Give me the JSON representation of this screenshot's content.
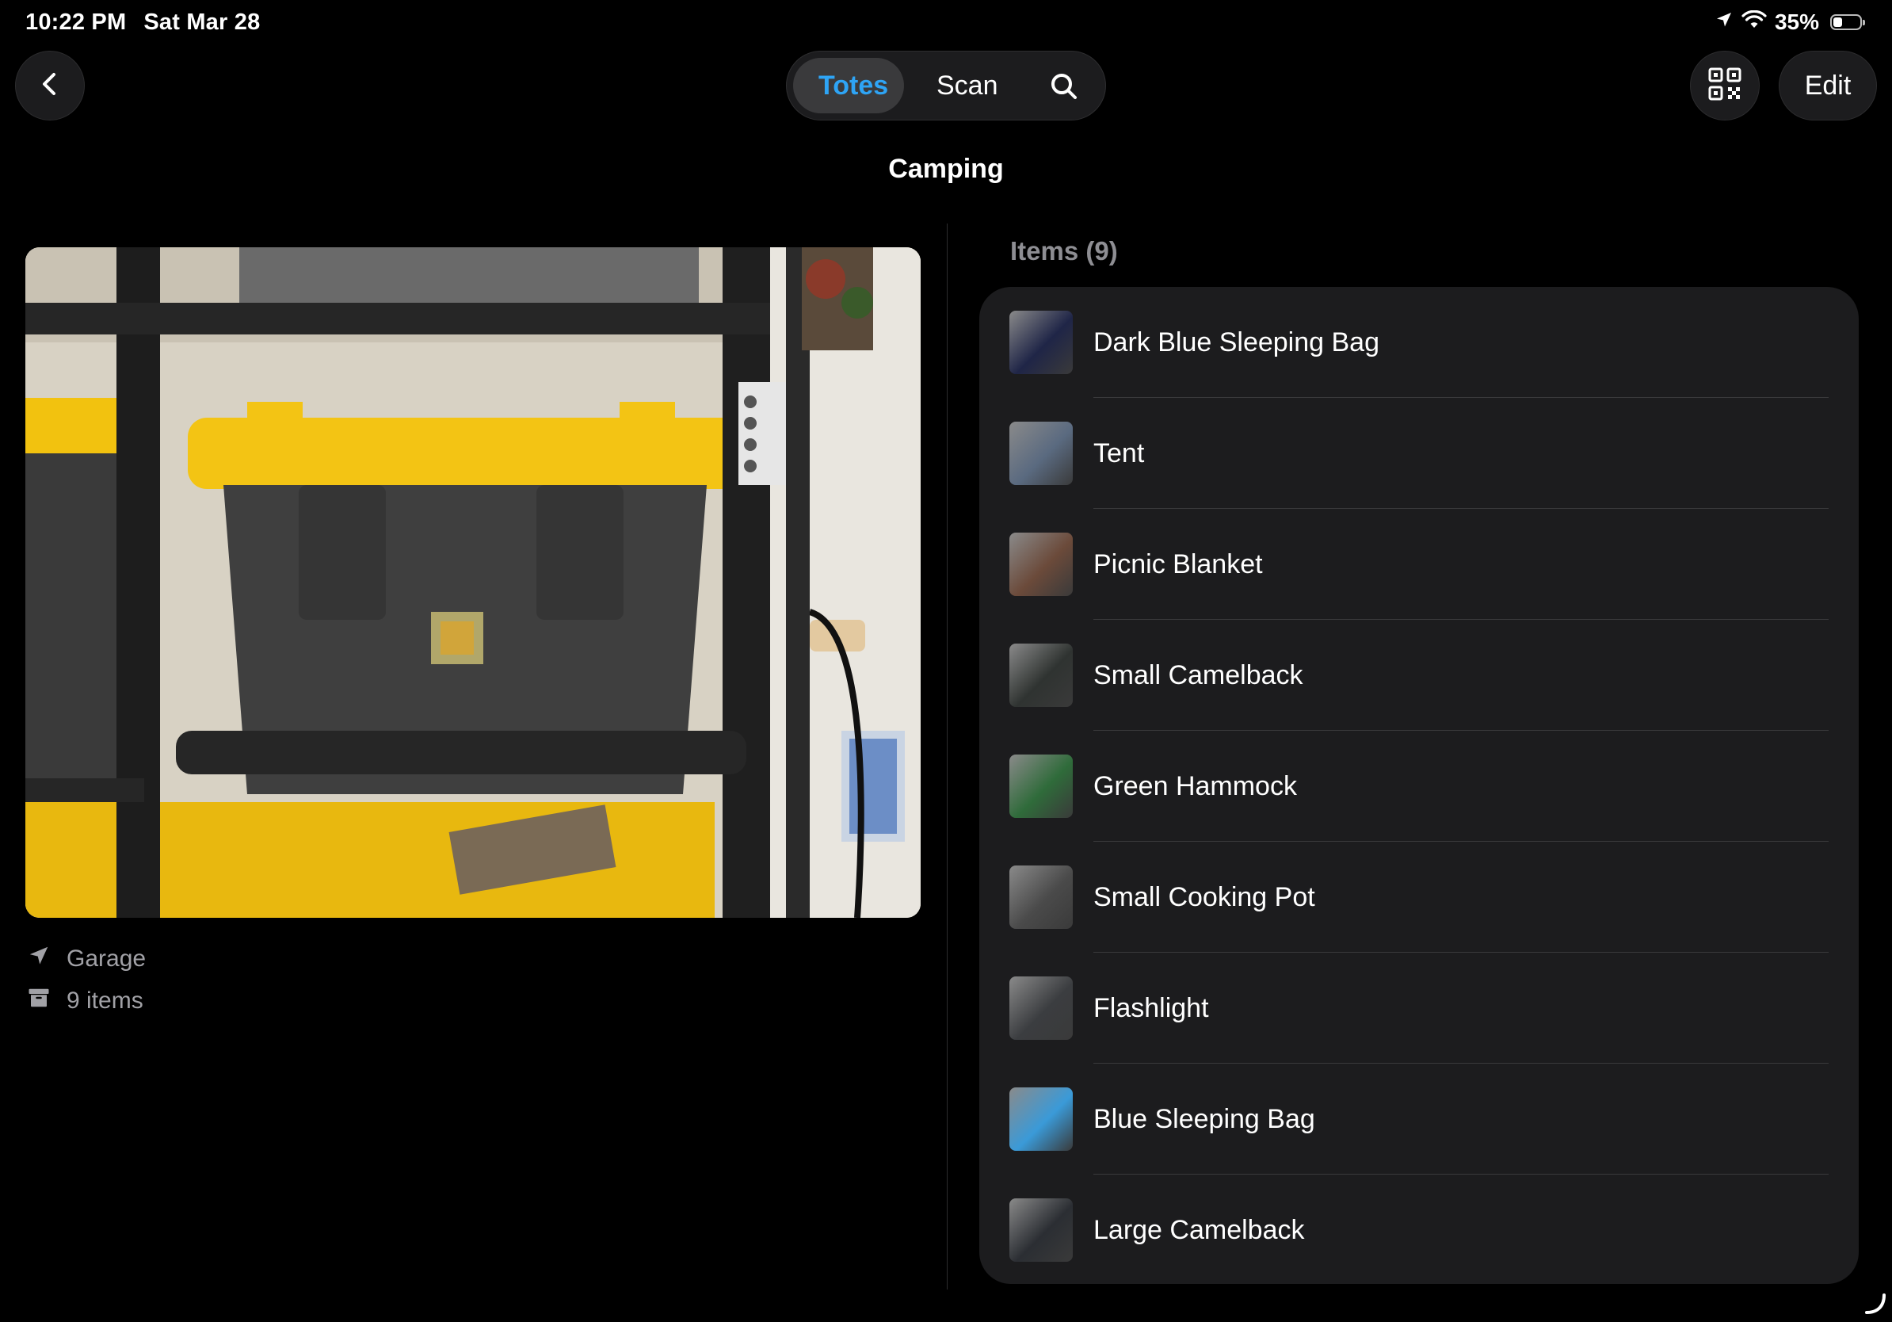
{
  "status_bar": {
    "time": "10:22 PM",
    "date": "Sat Mar 28",
    "battery_text": "35%",
    "battery_level": 0.35,
    "icons": [
      "location-arrow-icon",
      "wifi-icon",
      "battery-icon"
    ]
  },
  "nav": {
    "back_icon": "chevron-left-icon",
    "segments": {
      "totes": "Totes",
      "scan": "Scan",
      "search_icon": "search-icon"
    },
    "selected_segment": "totes",
    "qr_icon": "qr-code-icon",
    "edit_label": "Edit"
  },
  "page": {
    "title": "Camping"
  },
  "tote": {
    "location": "Garage",
    "count_text": "9 items",
    "location_icon": "location-arrow-icon",
    "count_icon": "archive-box-icon"
  },
  "items": {
    "header": "Items (9)",
    "list": [
      {
        "name": "Dark Blue Sleeping Bag",
        "thumb_color": "#1f2547"
      },
      {
        "name": "Tent",
        "thumb_color": "#5a6a80"
      },
      {
        "name": "Picnic Blanket",
        "thumb_color": "#6b4a3a"
      },
      {
        "name": "Small Camelback",
        "thumb_color": "#2f3331"
      },
      {
        "name": "Green Hammock",
        "thumb_color": "#2f6b3a"
      },
      {
        "name": "Small Cooking Pot",
        "thumb_color": "#4a4a4a"
      },
      {
        "name": "Flashlight",
        "thumb_color": "#3b3d40"
      },
      {
        "name": "Blue Sleeping Bag",
        "thumb_color": "#3a9ad8"
      },
      {
        "name": "Large Camelback",
        "thumb_color": "#2b2e33"
      }
    ]
  },
  "colors": {
    "accent": "#2ea4f5",
    "card": "#1c1c1e",
    "background": "#000000",
    "secondary_text": "#8e8e93"
  }
}
